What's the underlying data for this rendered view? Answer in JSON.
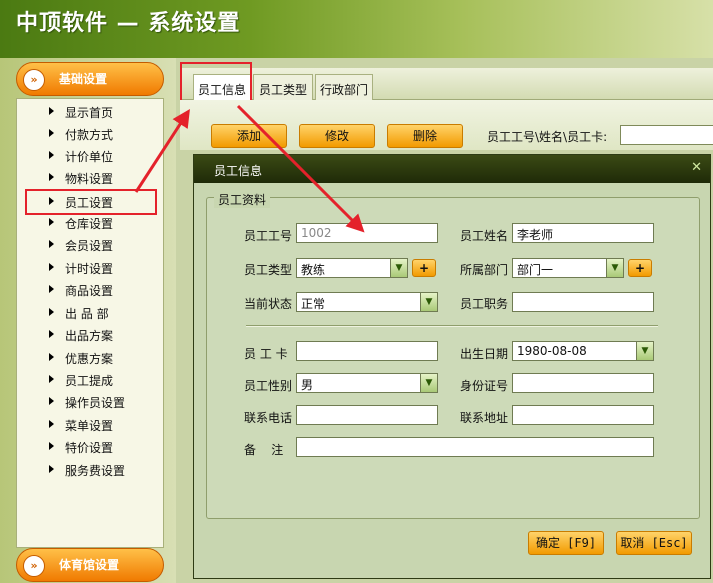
{
  "app": {
    "title": "中顶软件 — 系统设置"
  },
  "sidebar": {
    "section_basic": "基础设置",
    "section_gym": "体育馆设置",
    "items": [
      "显示首页",
      "付款方式",
      "计价单位",
      "物料设置",
      "员工设置",
      "仓库设置",
      "会员设置",
      "计时设置",
      "商品设置",
      "出 品 部",
      "出品方案",
      "优惠方案",
      "员工提成",
      "操作员设置",
      "菜单设置",
      "特价设置",
      "服务费设置"
    ],
    "selected": "员工设置"
  },
  "tabs": [
    "员工信息",
    "员工类型",
    "行政部门"
  ],
  "toolbar": {
    "add": "添加",
    "edit": "修改",
    "delete": "删除",
    "search_label": "员工工号\\姓名\\员工卡:",
    "search_value": ""
  },
  "dialog": {
    "title": "员工信息",
    "close": "✕",
    "group_title": "员工资料",
    "fields": {
      "emp_no_label": "员工工号",
      "emp_no_value": "1002",
      "emp_name_label": "员工姓名",
      "emp_name_value": "李老师",
      "emp_type_label": "员工类型",
      "emp_type_value": "教练",
      "dept_label": "所属部门",
      "dept_value": "部门一",
      "status_label": "当前状态",
      "status_value": "正常",
      "position_label": "员工职务",
      "position_value": "",
      "card_label": "员 工 卡",
      "card_value": "",
      "birth_label": "出生日期",
      "birth_value": "1980-08-08",
      "gender_label": "员工性别",
      "gender_value": "男",
      "id_label": "身份证号",
      "id_value": "",
      "phone_label": "联系电话",
      "phone_value": "",
      "address_label": "联系地址",
      "address_value": "",
      "note_label": "备    注",
      "note_value": ""
    },
    "confirm": "确定 [F9]",
    "cancel": "取消 [Esc]"
  },
  "colors": {
    "accent": "#f29a00",
    "highlight": "#e4222b"
  }
}
